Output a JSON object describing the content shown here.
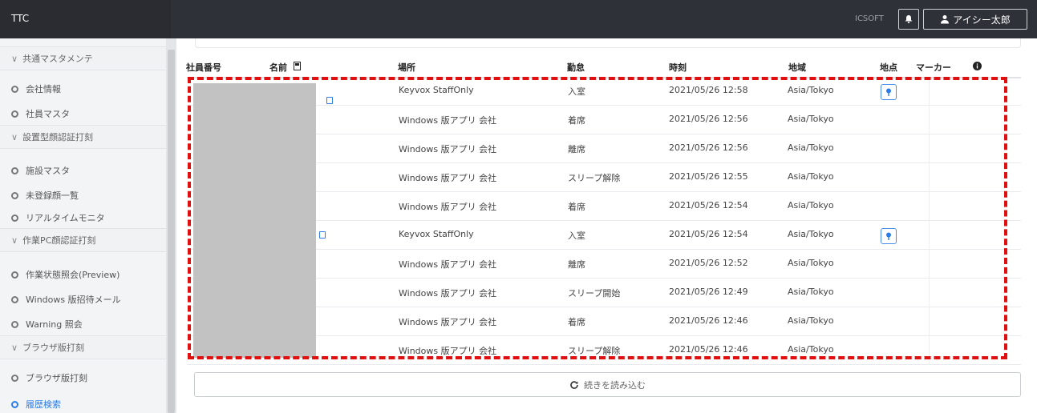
{
  "app": {
    "brand": "TTC",
    "company": "ICSOFT",
    "user_name": "アイシー太郎"
  },
  "sidebar": {
    "sections": [
      {
        "label": "共通マスタメンテ",
        "items": [
          "会社情報",
          "社員マスタ"
        ]
      },
      {
        "label": "設置型顔認証打刻",
        "items": [
          "施設マスタ",
          "未登録顔一覧",
          "リアルタイムモニタ"
        ]
      },
      {
        "label": "作業PC顔認証打刻",
        "items": [
          "作業状態照会(Preview)",
          "Windows 版招待メール",
          "Warning 照会"
        ]
      },
      {
        "label": "ブラウザ版打刻",
        "items": [
          "ブラウザ版打刻",
          "履歴検索"
        ]
      }
    ]
  },
  "table": {
    "headers": {
      "employee_no": "社員番号",
      "name": "名前",
      "place": "場所",
      "attendance": "勤怠",
      "time": "時刻",
      "region": "地域",
      "location": "地点",
      "marker": "マーカー"
    },
    "rows": [
      {
        "place": "Keyvox StaffOnly",
        "attendance": "入室",
        "time": "2021/05/26 12:58",
        "region": "Asia/Tokyo",
        "has_pin": true
      },
      {
        "place": "Windows 版アプリ 会社",
        "attendance": "着席",
        "time": "2021/05/26 12:56",
        "region": "Asia/Tokyo",
        "has_pin": false
      },
      {
        "place": "Windows 版アプリ 会社",
        "attendance": "離席",
        "time": "2021/05/26 12:56",
        "region": "Asia/Tokyo",
        "has_pin": false
      },
      {
        "place": "Windows 版アプリ 会社",
        "attendance": "スリープ解除",
        "time": "2021/05/26 12:55",
        "region": "Asia/Tokyo",
        "has_pin": false
      },
      {
        "place": "Windows 版アプリ 会社",
        "attendance": "着席",
        "time": "2021/05/26 12:54",
        "region": "Asia/Tokyo",
        "has_pin": false
      },
      {
        "place": "Keyvox StaffOnly",
        "attendance": "入室",
        "time": "2021/05/26 12:54",
        "region": "Asia/Tokyo",
        "has_pin": true
      },
      {
        "place": "Windows 版アプリ 会社",
        "attendance": "離席",
        "time": "2021/05/26 12:52",
        "region": "Asia/Tokyo",
        "has_pin": false
      },
      {
        "place": "Windows 版アプリ 会社",
        "attendance": "スリープ開始",
        "time": "2021/05/26 12:49",
        "region": "Asia/Tokyo",
        "has_pin": false
      },
      {
        "place": "Windows 版アプリ 会社",
        "attendance": "着席",
        "time": "2021/05/26 12:46",
        "region": "Asia/Tokyo",
        "has_pin": false
      },
      {
        "place": "Windows 版アプリ 会社",
        "attendance": "スリープ解除",
        "time": "2021/05/26 12:46",
        "region": "Asia/Tokyo",
        "has_pin": false
      }
    ]
  },
  "load_more": {
    "label": "続きを読み込む"
  },
  "colors": {
    "topbar": "#2f3138",
    "accent": "#2b7de9",
    "annotation": "#e01010",
    "redacted": "#c2c2c2"
  }
}
